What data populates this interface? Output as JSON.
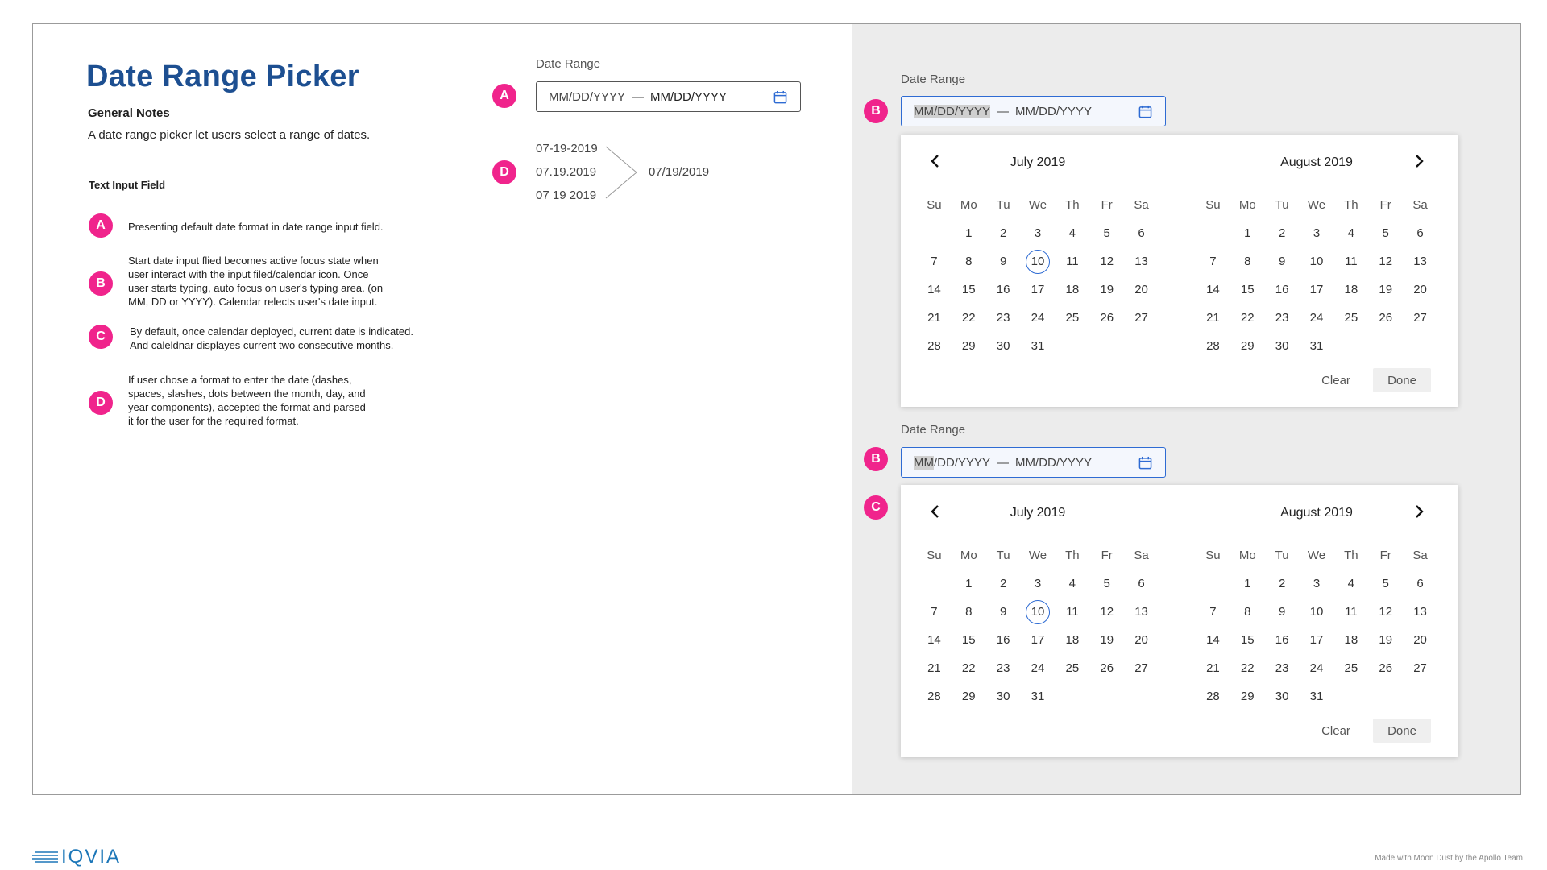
{
  "title": "Date Range Picker",
  "general_notes": {
    "heading": "General Notes",
    "description": "A date range picker let users select a range of dates."
  },
  "section_heading": "Text Input Field",
  "notes": [
    {
      "badge": "A",
      "text": "Presenting default date format in date range input field."
    },
    {
      "badge": "B",
      "text": "Start date input flied becomes active focus state when\nuser interact with the input filed/calendar icon. Once\nuser starts typing, auto focus on user's typing area. (on\nMM, DD or YYYY). Calendar relects user's date input."
    },
    {
      "badge": "C",
      "text": "By default, once calendar deployed, current date is indicated.\nAnd caleldnar displayes current two consecutive months."
    },
    {
      "badge": "D",
      "text": "If user chose a format to enter the date (dashes,\nspaces, slashes, dots between the month, day, and\nyear components), accepted the format and parsed\nit for the user for the required format."
    }
  ],
  "example_a": {
    "badge": "A",
    "label": "Date Range",
    "start": "MM/DD/YYYY",
    "separator": "—",
    "end": "MM/DD/YYYY"
  },
  "example_d": {
    "badge": "D",
    "inputs": [
      "07-19-2019",
      "07.19.2019",
      "07 19 2019"
    ],
    "output": "07/19/2019"
  },
  "picker1": {
    "badge": "B",
    "label": "Date Range",
    "start_highlight": "MM/DD/YYYY",
    "separator": "—",
    "end": "MM/DD/YYYY"
  },
  "picker2": {
    "badge_field": "B",
    "badge_calendar": "C",
    "label": "Date Range",
    "start_highlight": "MM",
    "start_rest": "/DD/YYYY",
    "separator": "—",
    "end": "MM/DD/YYYY"
  },
  "calendar": {
    "weekdays": [
      "Su",
      "Mo",
      "Tu",
      "We",
      "Th",
      "Fr",
      "Sa"
    ],
    "months": [
      {
        "title": "July 2019",
        "offset": 1,
        "days": 31,
        "today": 10
      },
      {
        "title": "August 2019",
        "offset": 1,
        "days": 31,
        "today": null
      }
    ],
    "clear_label": "Clear",
    "done_label": "Done"
  },
  "colors": {
    "accent_pink": "#f0248c",
    "brand_blue": "#1d4f91",
    "focus_blue": "#2e6bd3"
  },
  "icons": [
    "calendar-icon",
    "chevron-left-icon",
    "chevron-right-icon",
    "arrow-merge-icon",
    "iqvia-logo"
  ],
  "logo_text": "IQVIA",
  "footer": "Made with Moon Dust by the Apollo Team"
}
